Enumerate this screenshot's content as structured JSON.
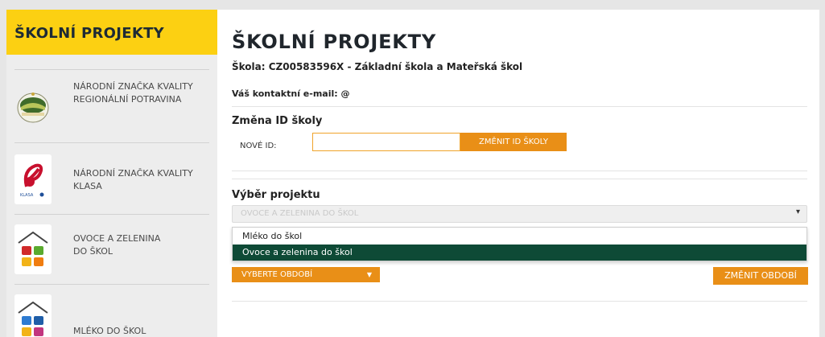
{
  "sidebar": {
    "title": "ŠKOLNÍ PROJEKTY",
    "items": [
      {
        "label": "NÁRODNÍ ZNAČKA KVALITY REGIONÁLNÍ POTRAVINA",
        "icon": "regional-food-logo-icon"
      },
      {
        "label": "NÁRODNÍ ZNAČKA KVALITY KLASA",
        "icon": "klasa-logo-icon"
      },
      {
        "label": "OVOCE A ZELENINA DO ŠKOL",
        "icon": "fruit-vegetables-school-icon"
      },
      {
        "label": "MLÉKO DO ŠKOL",
        "icon": "milk-school-icon"
      }
    ]
  },
  "main": {
    "title": "ŠKOLNÍ PROJEKTY",
    "school": "Škola: CZ00583596X - Základní škola a Mateřská škol",
    "email": "Váš kontaktní e-mail: @",
    "change_id": {
      "heading": "Změna ID školy",
      "label": "NOVÉ ID:",
      "value": "",
      "button": "ZMĚNIT ID ŠKOLY"
    },
    "project": {
      "heading": "Výběr projektu",
      "selected": "OVOCE A ZELENINA DO ŠKOL",
      "options": [
        "Mléko do škol",
        "Ovoce a zelenina do škol"
      ],
      "highlighted_index": 1
    },
    "period_button": "VYBERTE OBDOBÍ",
    "change_period_button": "ZMĚNIT OBDOBÍ"
  },
  "colors": {
    "sidebar_header": "#fcd012",
    "accent_orange": "#e98f17",
    "selected_option": "#0e4a36"
  }
}
